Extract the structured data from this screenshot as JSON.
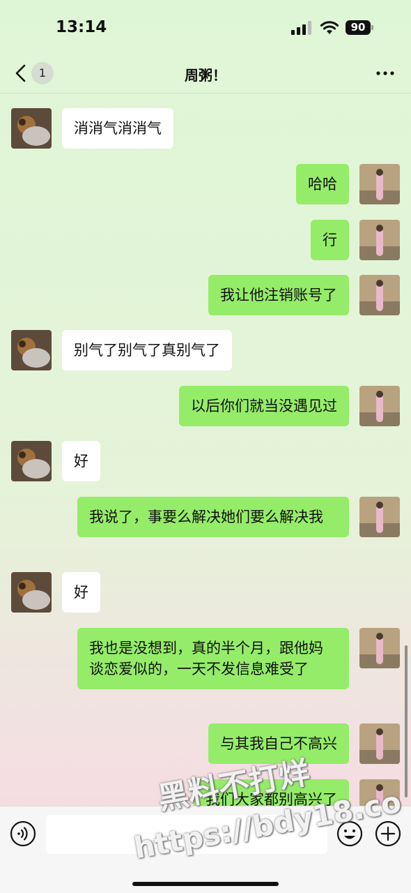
{
  "status": {
    "time": "13:14",
    "battery": "90"
  },
  "nav": {
    "unread_count": "1",
    "title": "周粥！"
  },
  "messages": [
    {
      "side": "in",
      "text": "消消气消消气"
    },
    {
      "side": "out",
      "text": "哈哈"
    },
    {
      "side": "out",
      "text": "行"
    },
    {
      "side": "out",
      "text": "我让他注销账号了"
    },
    {
      "side": "in",
      "text": "别气了别气了真别气了"
    },
    {
      "side": "out",
      "text": "以后你们就当没遇见过"
    },
    {
      "side": "in",
      "text": "好"
    },
    {
      "side": "out",
      "text": "我说了，事要么解决她们要么解决我"
    },
    {
      "side": "in",
      "text": "好"
    },
    {
      "side": "out",
      "text": "我也是没想到，真的半个月，跟他妈谈恋爱似的，一天不发信息难受了"
    },
    {
      "side": "out",
      "text": "与其我自己不高兴"
    },
    {
      "side": "out",
      "text": "我们大家都别高兴了"
    }
  ],
  "watermark": {
    "line1": "黑料不打烊",
    "line2": "https://bdy18.co"
  },
  "icons": {
    "back": "chevron-left-icon",
    "more": "more-dots-icon",
    "voice": "voice-icon",
    "emoji": "emoji-icon",
    "plus": "plus-icon"
  },
  "colors": {
    "outgoing_bubble": "#95ec69",
    "incoming_bubble": "#ffffff"
  }
}
